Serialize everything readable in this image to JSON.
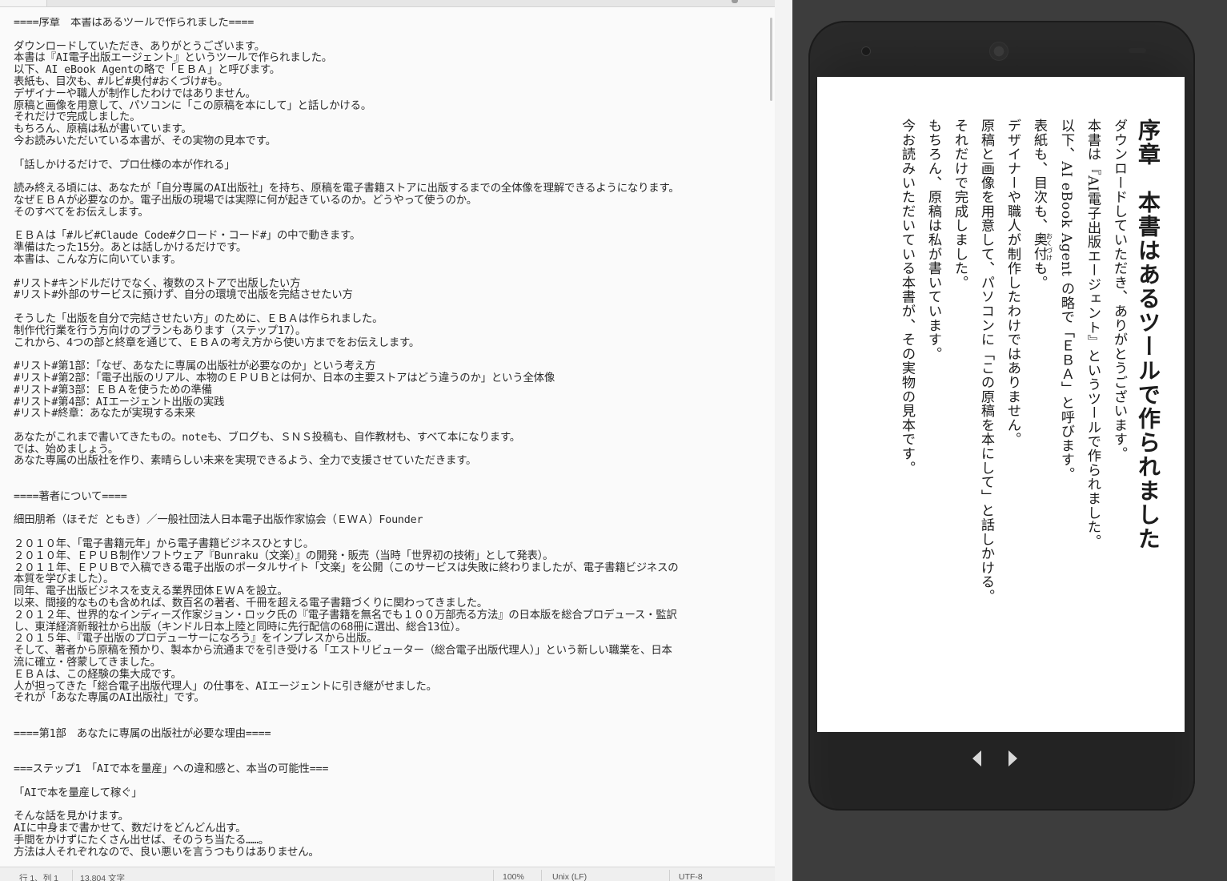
{
  "editor": {
    "lines": [
      "====序章　本書はあるツールで作られました====",
      "",
      "ダウンロードしていただき、ありがとうございます。",
      "本書は『AI電子出版エージェント』というツールで作られました。",
      "以下、AI eBook Agentの略で「ＥＢＡ」と呼びます。",
      "表紙も、目次も、#ルビ#奥付#おくづけ#も。",
      "デザイナーや職人が制作したわけではありません。",
      "原稿と画像を用意して、パソコンに「この原稿を本にして」と話しかける。",
      "それだけで完成しました。",
      "もちろん、原稿は私が書いています。",
      "今お読みいただいている本書が、その実物の見本です。",
      "",
      "「話しかけるだけで、プロ仕様の本が作れる」",
      "",
      "読み終える頃には、あなたが「自分専属のAI出版社」を持ち、原稿を電子書籍ストアに出版するまでの全体像を理解できるようになります。",
      "なぜＥＢＡが必要なのか。電子出版の現場では実際に何が起きているのか。どうやって使うのか。",
      "そのすべてをお伝えします。",
      "",
      "ＥＢＡは「#ルビ#Claude Code#クロード・コード#」の中で動きます。",
      "準備はたった15分。あとは話しかけるだけです。",
      "本書は、こんな方に向いています。",
      "",
      "#リスト#キンドルだけでなく、複数のストアで出版したい方",
      "#リスト#外部のサービスに預けず、自分の環境で出版を完結させたい方",
      "",
      "そうした「出版を自分で完結させたい方」のために、ＥＢＡは作られました。",
      "制作代行業を行う方向けのプランもあります（ステップ17）。",
      "これから、4つの部と終章を通じて、ＥＢＡの考え方から使い方までをお伝えします。",
      "",
      "#リスト#第1部：「なぜ、あなたに専属の出版社が必要なのか」という考え方",
      "#リスト#第2部：「電子出版のリアル、本物のＥＰＵＢとは何か、日本の主要ストアはどう違うのか」という全体像",
      "#リスト#第3部：ＥＢＡを使うための準備",
      "#リスト#第4部：AIエージェント出版の実践",
      "#リスト#終章：あなたが実現する未来",
      "",
      "あなたがこれまで書いてきたもの。noteも、ブログも、ＳＮＳ投稿も、自作教材も、すべて本になります。",
      "では、始めましょう。",
      "あなた専属の出版社を作り、素晴らしい未来を実現できるよう、全力で支援させていただきます。",
      "",
      "",
      "====著者について====",
      "",
      "細田朋希（ほそだ ともき）／一般社団法人日本電子出版作家協会（ＥＷＡ）Founder",
      "",
      "２０１０年、「電子書籍元年」から電子書籍ビジネスひとすじ。",
      "２０１０年、ＥＰＵＢ制作ソフトウェア『Bunraku（文楽）』の開発・販売（当時「世界初の技術」として発表）。",
      "２０１１年、ＥＰＵＢで入稿できる電子出版のポータルサイト「文楽」を公開（このサービスは失敗に終わりましたが、電子書籍ビジネスの",
      "本質を学びました）。",
      "同年、電子出版ビジネスを支える業界団体ＥＷＡを設立。",
      "以来、間接的なものも含めれば、数百名の著者、千冊を超える電子書籍づくりに関わってきました。",
      "２０１２年、世界的なインディーズ作家ジョン・ロック氏の『電子書籍を無名でも１００万部売る方法』の日本版を総合プロデュース・監訳",
      "し、東洋経済新報社から出版（キンドル日本上陸と同時に先行配信の68冊に選出、総合13位）。",
      "２０１５年、『電子出版のプロデューサーになろう』をインプレスから出版。",
      "そして、著者から原稿を預かり、製本から流通までを引き受ける「エストリビューター（総合電子出版代理人）」という新しい職業を、日本",
      "流に確立・啓蒙してきました。",
      "ＥＢＡは、この経験の集大成です。",
      "人が担ってきた「総合電子出版代理人」の仕事を、AIエージェントに引き継がせました。",
      "それが「あなた専属のAI出版社」です。",
      "",
      "",
      "====第1部　あなたに専属の出版社が必要な理由====",
      "",
      "",
      "===ステップ1　「AIで本を量産」への違和感と、本当の可能性===",
      "",
      "「AIで本を量産して稼ぐ」",
      "",
      "そんな話を見かけます。",
      "AIに中身まで書かせて、数だけをどんどん出す。",
      "手間をかけずにたくさん出せば、そのうち当たる……。",
      "方法は人それぞれなので、良い悪いを言うつもりはありません。"
    ],
    "status": {
      "position": "行 1、列 1",
      "chars": "13,804 文字",
      "zoom": "100%",
      "line_ending": "Unix (LF)",
      "encoding": "UTF-8"
    }
  },
  "preview": {
    "title": "序章　本書はあるツールで作られました",
    "paragraphs": {
      "p1": "ダウンロードしていただき、ありがとうございます。",
      "p2": "本書は『AI電子出版エージェント』というツールで作られました。",
      "p3": "以下、AI eBook Agent の略で「ＥＢＡ」と呼びます。",
      "p4a": "表紙も、目次も、",
      "p4_ruby_base": "奥付",
      "p4_ruby_text": "おくづけ",
      "p4b": "も。",
      "p5": "デザイナーや職人が制作したわけではありません。",
      "p6": "原稿と画像を用意して、パソコンに「この原稿を本にして」と話しかける。",
      "p7": "それだけで完成しました。",
      "p8": "もちろん、原稿は私が書いています。",
      "p9": "今お読みいただいている本書が、その実物の見本です。"
    },
    "nav": {
      "prev_icon": "triangle-left-icon",
      "next_icon": "triangle-right-icon",
      "color": "#d8d8d8"
    }
  }
}
